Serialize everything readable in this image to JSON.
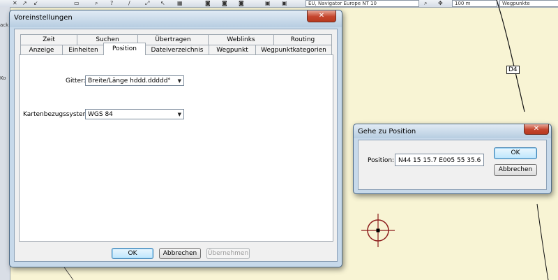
{
  "app": {
    "combo_map": "EU, Navigator Europe NT 10",
    "combo_zoom": "100 m",
    "combo_mode": "Wegpunkte",
    "left_strip_items": [
      "ack",
      "Ko"
    ]
  },
  "map": {
    "road_label": "D4"
  },
  "prefs_dialog": {
    "title": "Voreinstellungen",
    "tabs_row_back": [
      "Zeit",
      "Suchen",
      "Übertragen",
      "Weblinks",
      "Routing"
    ],
    "tabs_row_front": [
      "Anzeige",
      "Einheiten",
      "Position",
      "Dateiverzeichnis",
      "Wegpunkt",
      "Wegpunktkategorien"
    ],
    "active_tab": "Position",
    "grid_label": "Gitter:",
    "grid_value": "Breite/Länge hddd.ddddd°",
    "datum_label": "Kartenbezugssystem:",
    "datum_value": "WGS 84",
    "ok_label": "OK",
    "cancel_label": "Abbrechen",
    "apply_label": "Übernehmen"
  },
  "goto_dialog": {
    "title": "Gehe zu Position",
    "position_label": "Position:",
    "position_value": "N44 15 15.7 E005 55 35.6",
    "ok_label": "OK",
    "cancel_label": "Abbrechen"
  },
  "colors": {
    "map_background": "#f8f4d4",
    "window_frame": "#c7d9ea",
    "close_button": "#c4452d",
    "cursor_marker": "#8b1a1a"
  }
}
